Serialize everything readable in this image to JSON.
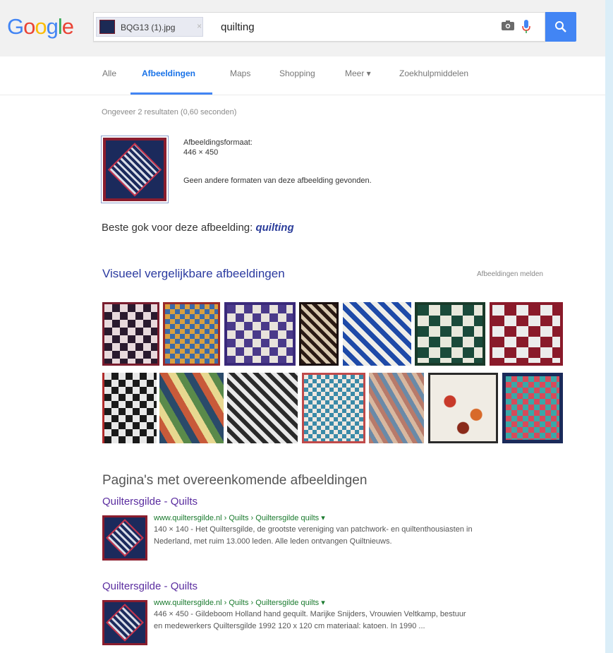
{
  "header": {
    "logo_text": "Google",
    "chip_filename": "BQG13 (1).jpg",
    "query": "quilting",
    "search_button_icon": "search-icon",
    "camera_icon": "camera-icon",
    "mic_icon": "mic-icon"
  },
  "tabs": [
    {
      "label": "Alle",
      "active": false
    },
    {
      "label": "Afbeeldingen",
      "active": true
    },
    {
      "label": "Maps",
      "active": false
    },
    {
      "label": "Shopping",
      "active": false
    },
    {
      "label": "Meer ▾",
      "active": false
    },
    {
      "label": "Zoekhulpmiddelen",
      "active": false
    }
  ],
  "stats": "Ongeveer 2 resultaten (0,60 seconden)",
  "image_info": {
    "format_label": "Afbeeldingsformaat:",
    "format_value": "446 × 450",
    "note": "Geen andere formaten van deze afbeelding gevonden."
  },
  "best_guess": {
    "prefix": "Beste gok voor deze afbeelding: ",
    "term": "quilting"
  },
  "similar": {
    "title": "Visueel vergelijkbare afbeeldingen",
    "report": "Afbeeldingen melden"
  },
  "pages": {
    "title": "Pagina's met overeenkomende afbeeldingen",
    "results": [
      {
        "title": "Quiltersgilde - Quilts",
        "url": "www.quiltersgilde.nl › Quilts › Quiltersgilde quilts ▾",
        "snippet1": "140 × 140 - Het Quiltersgilde, de grootste vereniging van patchwork- en quiltenthousiasten in",
        "snippet2": "Nederland, met ruim 13.000 leden. Alle leden ontvangen Quiltnieuws."
      },
      {
        "title": "Quiltersgilde - Quilts",
        "url": "www.quiltersgilde.nl › Quilts › Quiltersgilde quilts ▾",
        "snippet1": "446 × 450 - Gildeboom Holland hand gequilt. Marijke Snijders, Vrouwien Veltkamp, bestuur",
        "snippet2": "en medewerkers Quiltersgilde 1992 120 x 120 cm materiaal: katoen. In 1990 ..."
      }
    ]
  },
  "colors": {
    "accent": "#4285f4",
    "link_title": "#2b3aa0",
    "visited": "#5b2ea0",
    "url_green": "#1a7a2e"
  }
}
